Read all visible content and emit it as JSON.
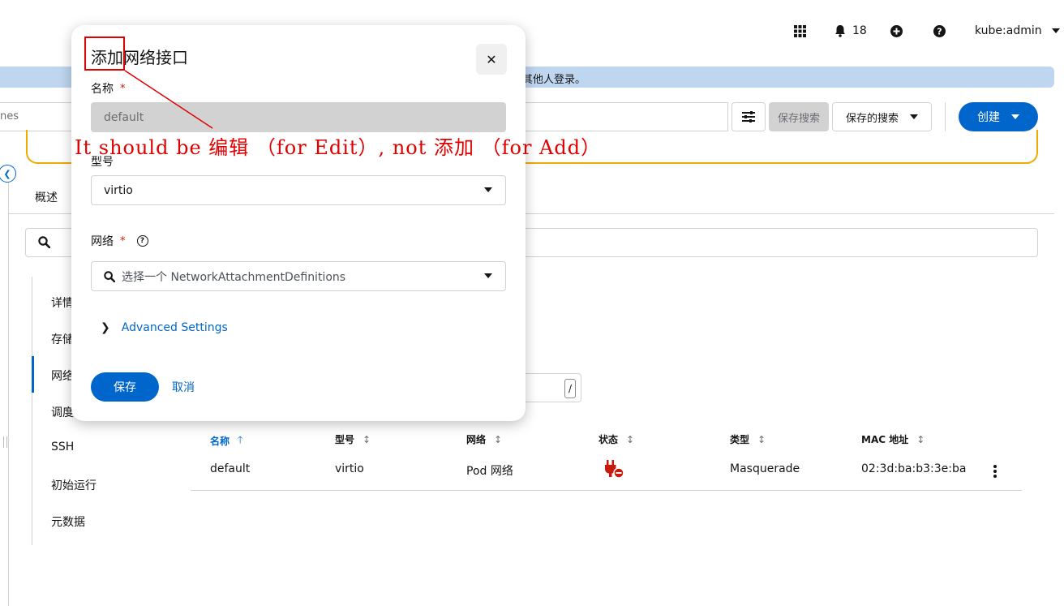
{
  "masthead": {
    "notification_count": "18",
    "user": "kube:admin",
    "icons": [
      "grid-icon",
      "bell-icon",
      "plus-circle-icon",
      "help-icon"
    ]
  },
  "banner": {
    "text": "其他人登录。"
  },
  "toolbar": {
    "search_text": "nes",
    "save_search_label": "保存搜索",
    "saved_search_label": "保存的搜索",
    "create_label": "创建"
  },
  "tabs": {
    "overview": "概述"
  },
  "vnav": {
    "items": [
      "详情",
      "存储",
      "网络",
      "调度",
      "SSH",
      "初始运行",
      "元数据"
    ],
    "active_index": 2
  },
  "filter": {
    "shortcut": "/"
  },
  "table": {
    "headers": [
      "名称",
      "型号",
      "网络",
      "状态",
      "类型",
      "MAC 地址"
    ],
    "sorted_column": 0,
    "rows": [
      {
        "name": "default",
        "model": "virtio",
        "network": "Pod 网络",
        "status_icon": "plug-disconnected-icon",
        "type": "Masquerade",
        "mac": "02:3d:ba:b3:3e:ba"
      }
    ]
  },
  "modal": {
    "title": "添加网络接口",
    "close_icon": "close-icon",
    "name_label": "名称",
    "required_mark": "*",
    "name_value": "default",
    "model_label": "型号",
    "model_value": "virtio",
    "network_label": "网络",
    "network_placeholder": "选择一个 NetworkAttachmentDefinitions",
    "advanced_label": "Advanced Settings",
    "save_label": "保存",
    "cancel_label": "取消"
  },
  "annotation": {
    "text": "It should be 编辑 （for Edit）, not 添加 （for Add）",
    "color": "#e00000"
  },
  "colors": {
    "accent": "#0066cc",
    "danger": "#c9190b",
    "warning": "#f0ab00",
    "banner": "#bed6f0"
  }
}
